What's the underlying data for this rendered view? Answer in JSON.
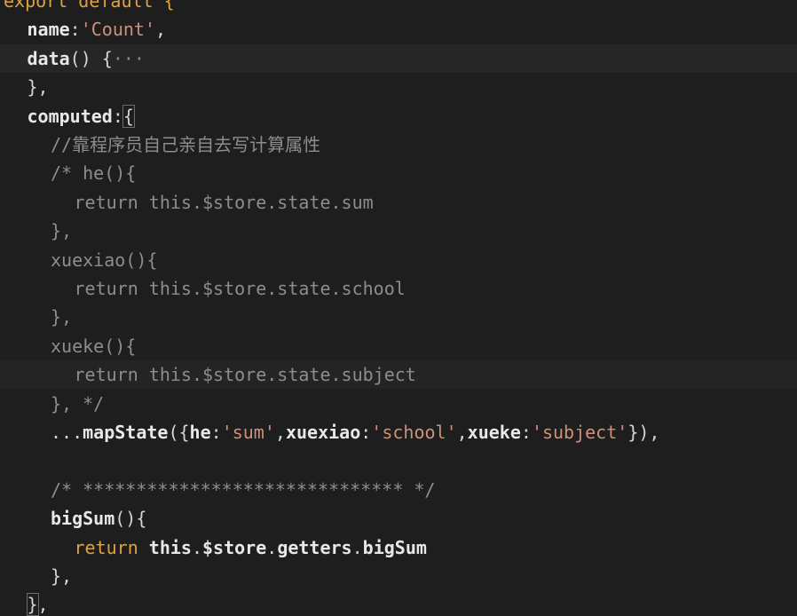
{
  "editor": {
    "lines": [
      {
        "indent": 0,
        "tokens": [
          {
            "c": "kw-orange",
            "t": "export default {"
          }
        ]
      },
      {
        "indent": 1,
        "tokens": [
          {
            "c": "bright",
            "t": "name"
          },
          {
            "c": "punc",
            "t": ":"
          },
          {
            "c": "str",
            "t": "'Count'"
          },
          {
            "c": "punc",
            "t": ","
          }
        ]
      },
      {
        "indent": 1,
        "hl": true,
        "tokens": [
          {
            "c": "bright",
            "t": "data"
          },
          {
            "c": "punc",
            "t": "() {"
          },
          {
            "c": "fold",
            "t": "···"
          }
        ]
      },
      {
        "indent": 1,
        "tokens": [
          {
            "c": "punc",
            "t": "},"
          }
        ]
      },
      {
        "indent": 1,
        "tokens": [
          {
            "c": "bright",
            "t": "computed"
          },
          {
            "c": "punc",
            "t": ":"
          },
          {
            "c": "punc bracket-hl",
            "t": "{"
          }
        ]
      },
      {
        "indent": 2,
        "tokens": [
          {
            "c": "comment",
            "t": "//靠程序员自己亲自去写计算属性"
          }
        ]
      },
      {
        "indent": 2,
        "tokens": [
          {
            "c": "comment",
            "t": "/* he(){"
          }
        ]
      },
      {
        "indent": 3,
        "tokens": [
          {
            "c": "comment",
            "t": "return this.$store.state.sum"
          }
        ]
      },
      {
        "indent": 2,
        "tokens": [
          {
            "c": "comment",
            "t": "},"
          }
        ]
      },
      {
        "indent": 2,
        "tokens": [
          {
            "c": "comment",
            "t": "xuexiao(){"
          }
        ]
      },
      {
        "indent": 3,
        "tokens": [
          {
            "c": "comment",
            "t": "return this.$store.state.school"
          }
        ]
      },
      {
        "indent": 2,
        "tokens": [
          {
            "c": "comment",
            "t": "},"
          }
        ]
      },
      {
        "indent": 2,
        "tokens": [
          {
            "c": "comment",
            "t": "xueke(){"
          }
        ]
      },
      {
        "indent": 3,
        "hl2": true,
        "tokens": [
          {
            "c": "comment",
            "t": "return this.$store.state.subject"
          }
        ]
      },
      {
        "indent": 2,
        "tokens": [
          {
            "c": "comment",
            "t": "}, */"
          }
        ]
      },
      {
        "indent": 2,
        "tokens": [
          {
            "c": "punc",
            "t": "..."
          },
          {
            "c": "bright",
            "t": "mapState"
          },
          {
            "c": "punc",
            "t": "({"
          },
          {
            "c": "bright",
            "t": "he"
          },
          {
            "c": "punc",
            "t": ":"
          },
          {
            "c": "str",
            "t": "'sum'"
          },
          {
            "c": "punc",
            "t": ","
          },
          {
            "c": "bright",
            "t": "xuexiao"
          },
          {
            "c": "punc",
            "t": ":"
          },
          {
            "c": "str",
            "t": "'school'"
          },
          {
            "c": "punc",
            "t": ","
          },
          {
            "c": "bright",
            "t": "xueke"
          },
          {
            "c": "punc",
            "t": ":"
          },
          {
            "c": "str",
            "t": "'subject'"
          },
          {
            "c": "punc",
            "t": "}),"
          }
        ]
      },
      {
        "indent": 0,
        "tokens": []
      },
      {
        "indent": 2,
        "tokens": [
          {
            "c": "comment",
            "t": "/* ****************************** */"
          }
        ]
      },
      {
        "indent": 2,
        "tokens": [
          {
            "c": "bright",
            "t": "bigSum"
          },
          {
            "c": "punc",
            "t": "(){"
          }
        ]
      },
      {
        "indent": 3,
        "tokens": [
          {
            "c": "kw-orange",
            "t": "return"
          },
          {
            "c": "punc",
            "t": " "
          },
          {
            "c": "bright",
            "t": "this"
          },
          {
            "c": "punc",
            "t": "."
          },
          {
            "c": "bright",
            "t": "$store"
          },
          {
            "c": "punc",
            "t": "."
          },
          {
            "c": "bright",
            "t": "getters"
          },
          {
            "c": "punc",
            "t": "."
          },
          {
            "c": "bright",
            "t": "bigSum"
          }
        ]
      },
      {
        "indent": 2,
        "tokens": [
          {
            "c": "punc",
            "t": "},"
          }
        ]
      },
      {
        "indent": 1,
        "tokens": [
          {
            "c": "punc bracket-hl",
            "t": "}"
          },
          {
            "c": "punc",
            "t": ","
          }
        ]
      }
    ]
  }
}
